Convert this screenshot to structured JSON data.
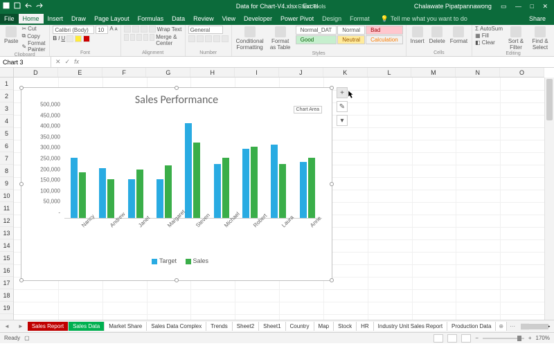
{
  "titlebar": {
    "filename": "Data for Chart-V4.xlsx - Excel",
    "context_label": "Chart Tools",
    "username": "Chalawate Pipatpannawong"
  },
  "menu": {
    "file": "File",
    "tabs": [
      "Home",
      "Insert",
      "Draw",
      "Page Layout",
      "Formulas",
      "Data",
      "Review",
      "View",
      "Developer",
      "Power Pivot"
    ],
    "context_tabs": [
      "Design",
      "Format"
    ],
    "active": "Home",
    "tellme": "Tell me what you want to do",
    "share": "Share"
  },
  "ribbon": {
    "clipboard": {
      "paste": "Paste",
      "cut": "Cut",
      "copy": "Copy",
      "fmt": "Format Painter",
      "label": "Clipboard"
    },
    "font": {
      "name": "Calibri (Body)",
      "size": "10",
      "label": "Font"
    },
    "alignment": {
      "wrap": "Wrap Text",
      "merge": "Merge & Center",
      "label": "Alignment"
    },
    "number": {
      "fmt": "General",
      "label": "Number"
    },
    "styles": {
      "cond": "Conditional Formatting",
      "fmttbl": "Format as Table",
      "normal_dat": "Normal_DAT",
      "normal": "Normal",
      "bad": "Bad",
      "good": "Good",
      "neutral": "Neutral",
      "calc": "Calculation",
      "label": "Styles"
    },
    "cells": {
      "insert": "Insert",
      "delete": "Delete",
      "format": "Format",
      "label": "Cells"
    },
    "editing": {
      "autosum": "AutoSum",
      "fill": "Fill",
      "clear": "Clear",
      "sort": "Sort & Filter",
      "find": "Find & Select",
      "label": "Editing"
    }
  },
  "namebox": {
    "value": "Chart 3",
    "fx": "fx"
  },
  "grid": {
    "cols": [
      "D",
      "E",
      "F",
      "G",
      "H",
      "I",
      "J",
      "K",
      "L",
      "M",
      "N",
      "O"
    ],
    "rows": [
      "1",
      "2",
      "3",
      "4",
      "5",
      "6",
      "7",
      "8",
      "9",
      "10",
      "11",
      "12",
      "13",
      "14",
      "15",
      "16",
      "17",
      "18",
      "19"
    ]
  },
  "chart_ui": {
    "area_tooltip": "Chart Area",
    "legend_target": "Target",
    "legend_sales": "Sales"
  },
  "chart_data": {
    "type": "bar",
    "title": "Sales Performance",
    "xlabel": "",
    "ylabel": "",
    "ylim": [
      0,
      500000
    ],
    "yticks": [
      "-",
      "50,000",
      "100,000",
      "150,000",
      "200,000",
      "250,000",
      "300,000",
      "350,000",
      "400,000",
      "450,000",
      "500,000"
    ],
    "categories": [
      "Nancy",
      "Andrew",
      "Janet",
      "Margaret",
      "Steven",
      "Michael",
      "Robert",
      "Laura",
      "Anne"
    ],
    "series": [
      {
        "name": "Target",
        "values": [
          280000,
          230000,
          180000,
          180000,
          440000,
          250000,
          320000,
          340000,
          260000
        ]
      },
      {
        "name": "Sales",
        "values": [
          210000,
          180000,
          225000,
          245000,
          350000,
          280000,
          330000,
          250000,
          280000
        ]
      }
    ]
  },
  "sheets": {
    "tabs": [
      "Sales Report",
      "Sales Data",
      "Market Share",
      "Sales Data Complex",
      "Trends",
      "Sheet2",
      "Sheet1",
      "Country",
      "Map",
      "Stock",
      "HR",
      "Industry Unit Sales Report",
      "Production Data"
    ],
    "active": "Sales Report"
  },
  "status": {
    "ready": "Ready",
    "zoom": "170%"
  }
}
